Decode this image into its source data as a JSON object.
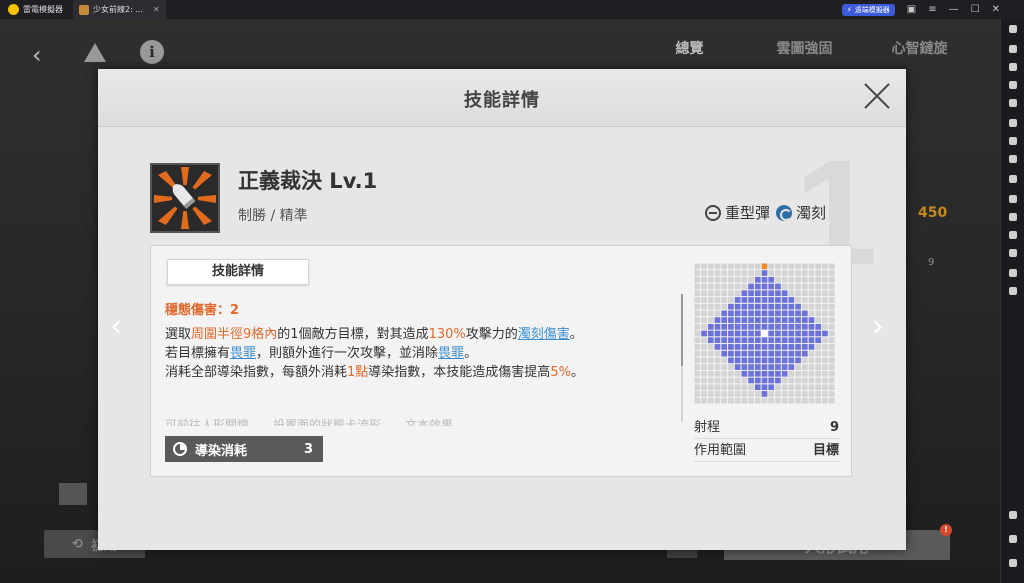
{
  "titlebar": {
    "app_name": "雷電模擬器",
    "tab_label": "少女前線2: ...",
    "tab_close": "✕",
    "speed_label": "遠端模擬器",
    "controls": [
      "▣",
      "≡",
      "—",
      "☐",
      "✕"
    ]
  },
  "game": {
    "top_tabs": [
      "總覽",
      "雲圖強固",
      "心智鏈旋"
    ],
    "gold_value": "450",
    "side_value": "9",
    "left_button": "初始",
    "right_button": "人形試用",
    "badge": "!"
  },
  "modal": {
    "title": "技能詳情",
    "big_number": "1",
    "skill": {
      "name": "正義裁決 Lv.1",
      "tags": "制勝 / 精準",
      "ammo": [
        "重型彈",
        "濁刻"
      ]
    },
    "details": {
      "tab_label": "技能詳情",
      "stability": "穩態傷害：2",
      "lines": [
        {
          "p1": "選取",
          "h1": "周圍半徑9格內",
          "p2": "的1個敵方目標，對其造成",
          "h2": "130%",
          "p3": "攻擊力的",
          "l1": "濁刻傷害",
          "p4": "。"
        },
        {
          "p1": "若目標擁有",
          "l1": "畏罪",
          "p2": "，則額外進行一次攻擊，並消除",
          "l2": "畏罪",
          "p3": "。"
        },
        {
          "p1": "消耗全部導染指數，每額外消耗",
          "h1": "1點",
          "p2": "導染指數，本技能造成傷害提高",
          "h2": "5%",
          "p3": "。"
        }
      ],
      "faded_line": "可前往人形關懷……設置面的狀態卡流形……文本效果",
      "cost_label": "導染消耗",
      "cost_value": "3"
    },
    "stats": [
      {
        "label": "射程",
        "value": "9"
      },
      {
        "label": "作用範圍",
        "value": "目標"
      }
    ],
    "range_grid": {
      "size": 21,
      "radius": 9,
      "colors": {
        "empty": "#d4d4d4",
        "range": "#6b72d9",
        "center": "#ffffff",
        "marker": "#f08a2e"
      }
    },
    "nav": {
      "prev": "‹",
      "next": "›"
    },
    "close_label": "close"
  }
}
